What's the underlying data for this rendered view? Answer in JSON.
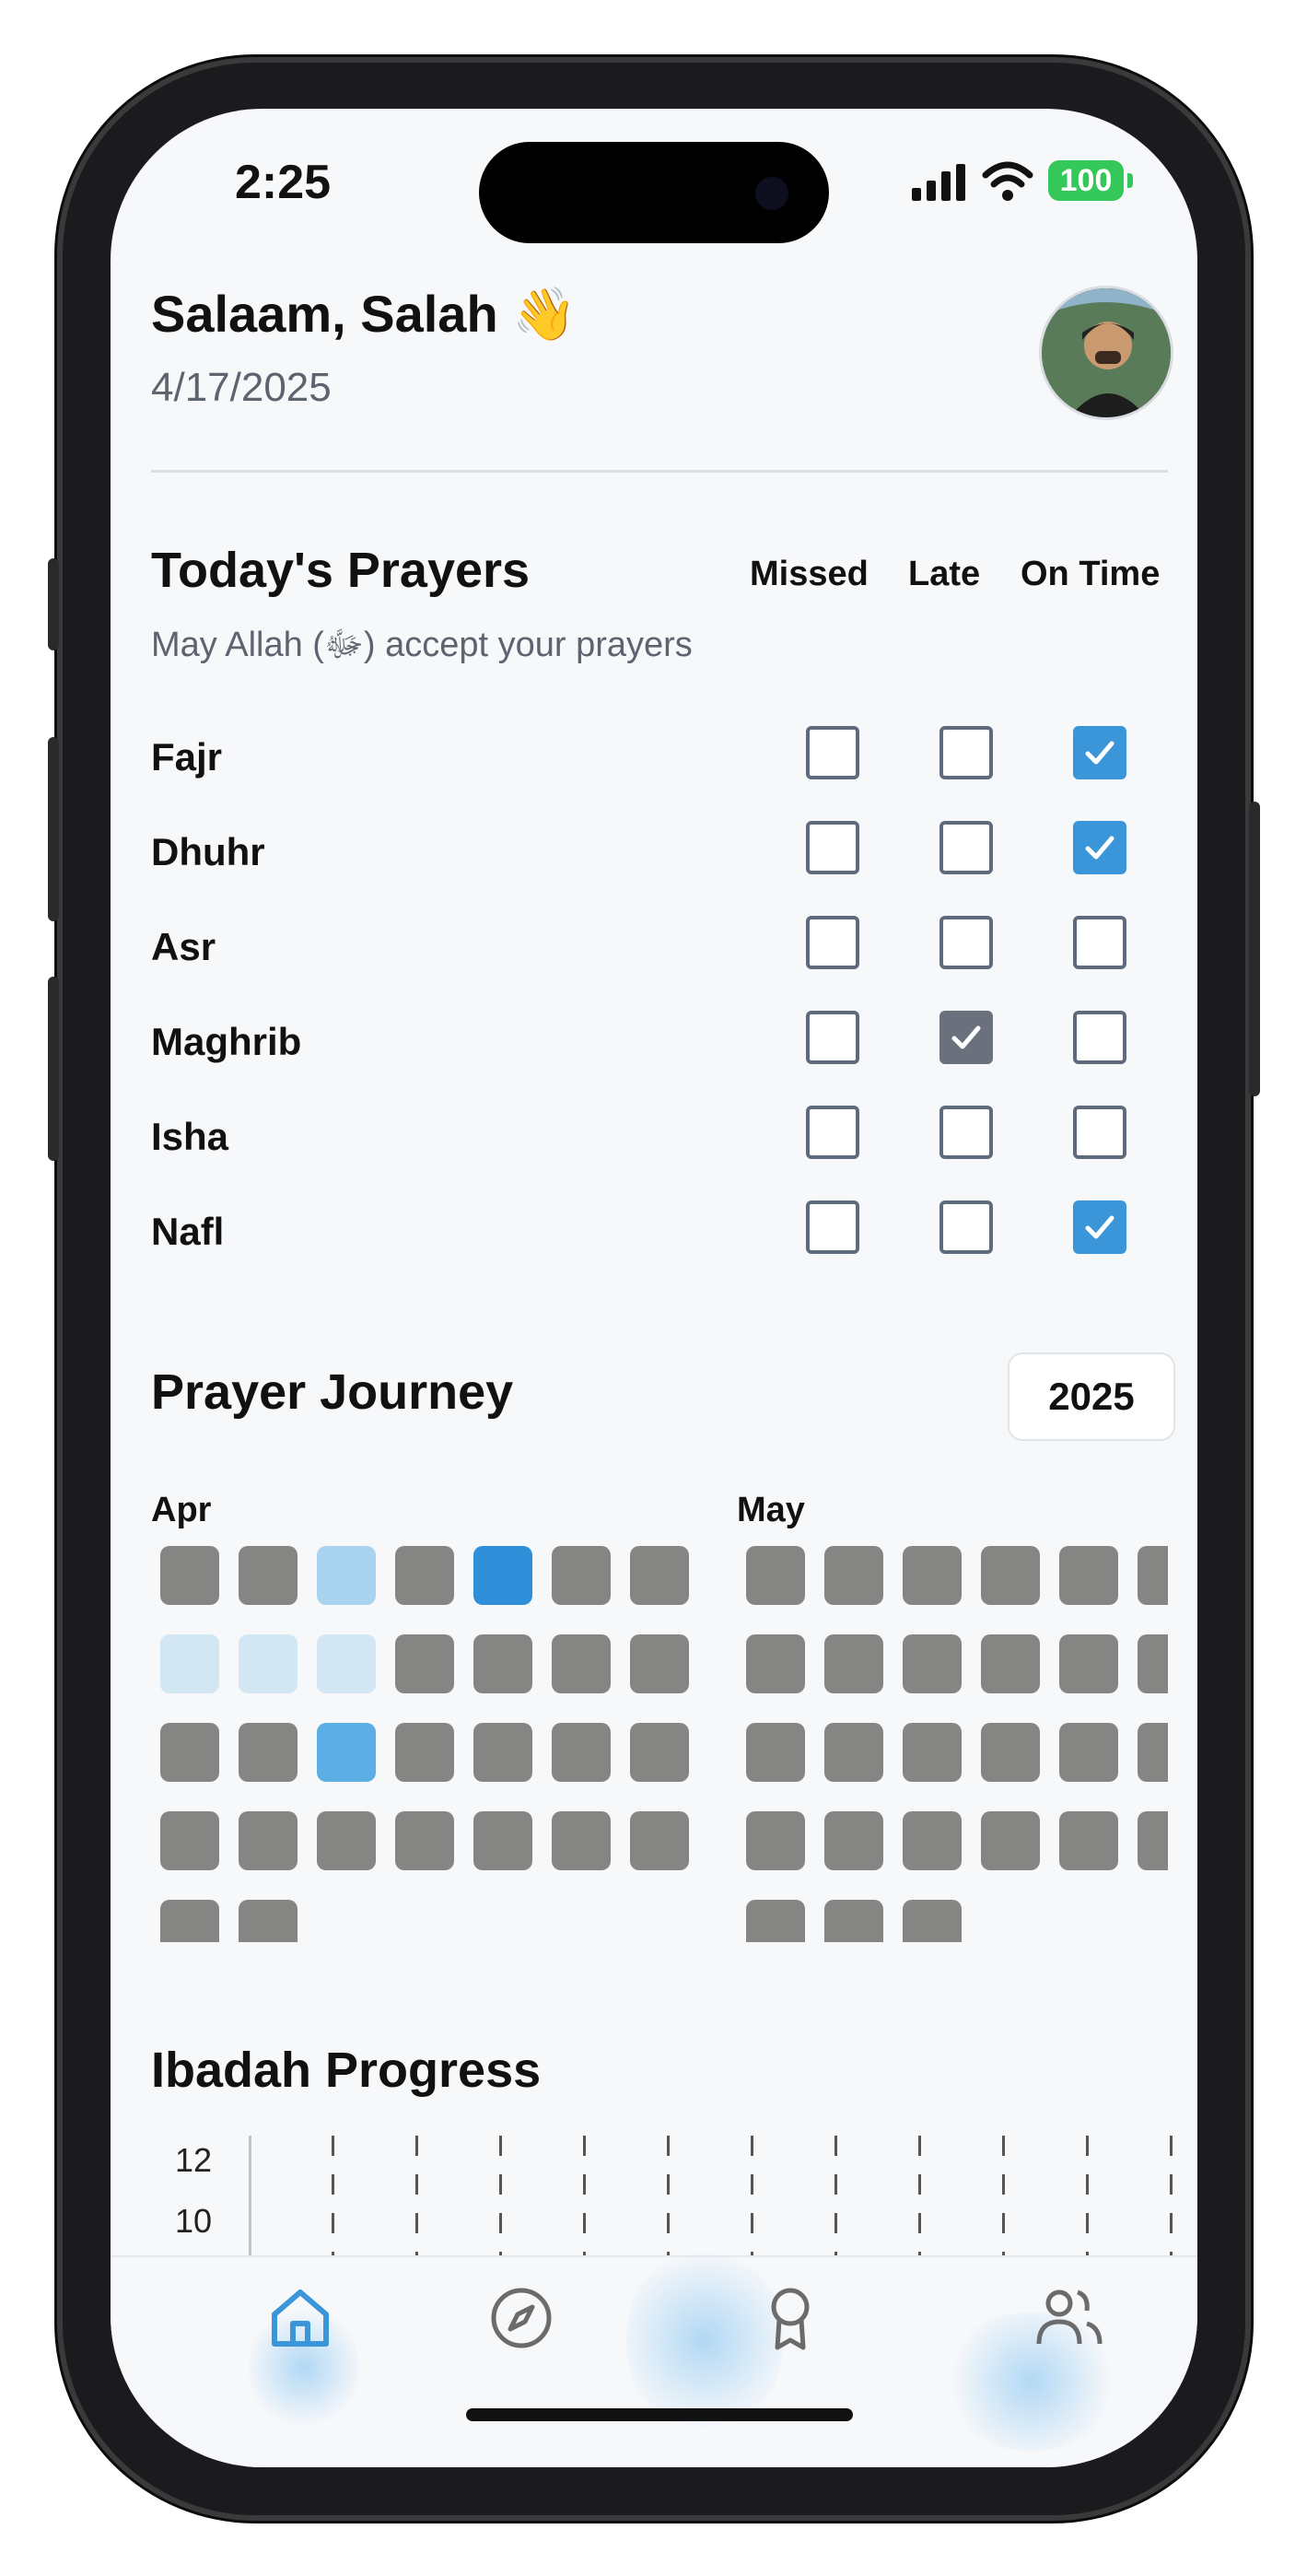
{
  "status_bar": {
    "time": "2:25",
    "battery": "100"
  },
  "header": {
    "greeting": "Salaam, Salah 👋",
    "date": "4/17/2025"
  },
  "todays_prayers": {
    "title": "Today's Prayers",
    "subtitle": "May Allah (ﷻ) accept your prayers",
    "columns": [
      "Missed",
      "Late",
      "On Time"
    ],
    "rows": [
      {
        "name": "Fajr",
        "status": "On Time"
      },
      {
        "name": "Dhuhr",
        "status": "On Time"
      },
      {
        "name": "Asr",
        "status": ""
      },
      {
        "name": "Maghrib",
        "status": "Late"
      },
      {
        "name": "Isha",
        "status": ""
      },
      {
        "name": "Nafl",
        "status": "On Time"
      }
    ]
  },
  "prayer_journey": {
    "title": "Prayer Journey",
    "year": "2025",
    "months": [
      {
        "label": "Apr",
        "days": [
          0,
          0,
          2,
          0,
          4,
          0,
          0,
          1,
          1,
          1,
          0,
          0,
          0,
          0,
          0,
          0,
          3,
          0,
          0,
          0,
          0,
          0,
          0,
          0,
          0,
          0,
          0,
          0,
          0,
          0
        ]
      },
      {
        "label": "May",
        "days": [
          0,
          0,
          0,
          0,
          0,
          0,
          0,
          0,
          0,
          0,
          0,
          0,
          0,
          0,
          0,
          0,
          0,
          0,
          0,
          0,
          0,
          0,
          0,
          0,
          0,
          0,
          0,
          0,
          0,
          0,
          0
        ]
      }
    ],
    "colors": {
      "0": "#858583",
      "1": "#d3e6f3",
      "2": "#a9d3ef",
      "3": "#5caee4",
      "4": "#2f8fd9"
    }
  },
  "ibadah_progress": {
    "title": "Ibadah Progress",
    "y_ticks": [
      "12",
      "10"
    ]
  },
  "tabbar": {
    "items": [
      {
        "icon": "home-icon",
        "active": true
      },
      {
        "icon": "compass-icon",
        "active": false
      },
      {
        "icon": "award-icon",
        "active": false
      },
      {
        "icon": "users-icon",
        "active": false
      }
    ],
    "accent": "#3b95d9"
  }
}
